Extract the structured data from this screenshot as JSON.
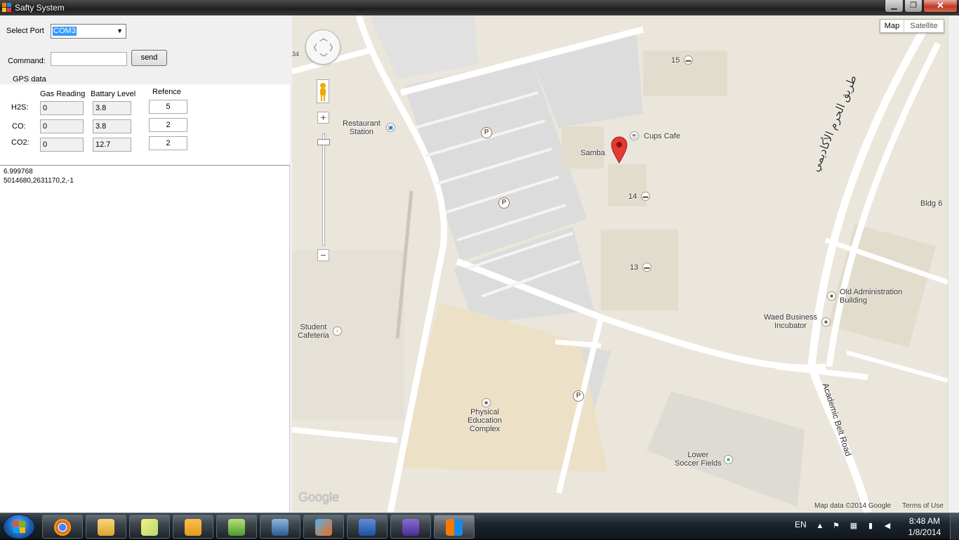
{
  "window": {
    "title": "Safty System"
  },
  "controls": {
    "select_port_label": "Select Port",
    "port_value": "COM3",
    "command_label": "Command:",
    "command_value": "",
    "send_label": "send",
    "gps_label": "GPS data"
  },
  "readings": {
    "headers": {
      "gas": "Gas Reading",
      "battery": "Battary Level",
      "reference": "Refence"
    },
    "rows": [
      {
        "label": "H2S:",
        "gas": "0",
        "battery": "3.8",
        "reference": "5"
      },
      {
        "label": "CO:",
        "gas": "0",
        "battery": "3.8",
        "reference": "2"
      },
      {
        "label": "CO2:",
        "gas": "0",
        "battery": "12.7",
        "reference": "2"
      }
    ]
  },
  "log": {
    "lines": [
      "6.999768",
      "5014680,2631170,2,-1"
    ]
  },
  "map": {
    "type_buttons": {
      "map": "Map",
      "satellite": "Satellite"
    },
    "labels": {
      "restaurant_station": "Restaurant\nStation",
      "samba": "Samba",
      "cups_cafe": "Cups Cafe",
      "building_15": "15",
      "building_14": "14",
      "building_13": "13",
      "student_cafeteria": "Student\nCafeteria",
      "physical_education": "Physical\nEducation\nComplex",
      "lower_soccer": "Lower\nSoccer Fields",
      "old_admin": "Old Administration\nBuilding",
      "waed": "Waed Business\nIncubator",
      "bldg6": "Bldg 6",
      "arabic_road": "طريق الحرم الأكاديمي",
      "academic_belt": "Academic Belt Road",
      "edge_34": "34"
    },
    "attribution": "Map data ©2014 Google",
    "terms": "Terms of Use",
    "logo": "Google",
    "zoom_in": "+",
    "zoom_out": "−"
  },
  "taskbar": {
    "language": "EN",
    "time": "8:48 AM",
    "date": "1/8/2014",
    "apps": [
      "chrome-icon",
      "file-explorer-icon",
      "sticky-notes-icon",
      "outlook-icon",
      "notepad-plus-icon",
      "virtualbox-icon",
      "matlab-icon",
      "word-icon",
      "visual-studio-icon",
      "safty-system-icon"
    ]
  },
  "colors": {
    "titlebar": "#2b2b2b",
    "selection": "#3399ff",
    "map_background": "#ebe6dc",
    "parking": "#dcdcdc",
    "pin": "#e53935",
    "taskbar": "#1c252d"
  }
}
